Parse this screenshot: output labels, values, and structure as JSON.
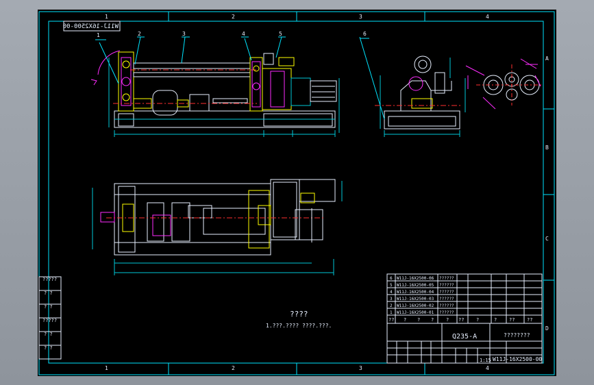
{
  "sheet": {
    "zone_numbers_top": [
      "1",
      "2",
      "3",
      "4"
    ],
    "zone_numbers_bottom": [
      "1",
      "2",
      "3",
      "4"
    ],
    "zone_letters": [
      "A",
      "B",
      "C",
      "D"
    ],
    "mirrored_drawing_number": "W11J-16X2500-00"
  },
  "callouts": [
    "1",
    "2",
    "3",
    "4",
    "5",
    "6"
  ],
  "notes": {
    "heading": "????",
    "line": "1.???.????  ????.???."
  },
  "parts_table": {
    "rows": [
      {
        "no": "6",
        "code": "W11J-16X2500-06",
        "name": "??????"
      },
      {
        "no": "5",
        "code": "W11J-16X2500-05",
        "name": "??????"
      },
      {
        "no": "4",
        "code": "W11J-16X2500-04",
        "name": "??????"
      },
      {
        "no": "3",
        "code": "W11J-16X2500-03",
        "name": "??????"
      },
      {
        "no": "2",
        "code": "W11J-16X2500-02",
        "name": "??????"
      },
      {
        "no": "1",
        "code": "W11J-16X2500-01",
        "name": "??????"
      }
    ],
    "header": [
      "??",
      "?",
      "?",
      "?",
      "?",
      "??",
      "?",
      "?",
      "??",
      "??"
    ]
  },
  "title_block": {
    "material": "Q235-A",
    "drawing_title": "????????",
    "drawing_number": "W11J-16X2500-00",
    "scale": "1:15"
  },
  "side_table": {
    "cells": [
      "?????",
      "?  ?",
      "?  ?",
      "?????",
      "?  ?",
      "?  ?"
    ]
  },
  "colors": {
    "frame": "#00e5ff",
    "text": "#e8f0ff",
    "accent_yellow": "#ffff00",
    "accent_magenta": "#ff2cff",
    "dim_cyan": "#00c8d8",
    "center_red": "#ff3030",
    "white": "#ffffff"
  }
}
